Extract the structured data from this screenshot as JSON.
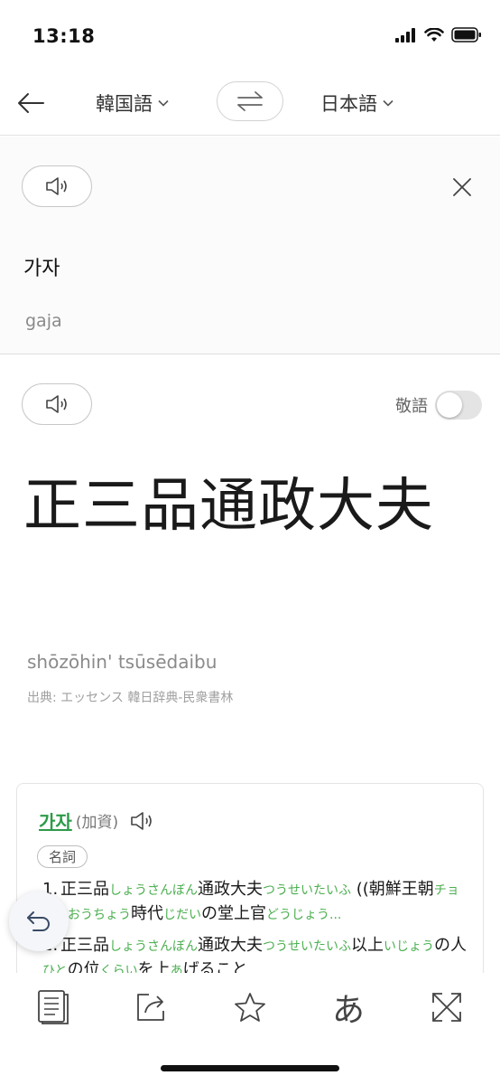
{
  "status_bar": {
    "time": "13:18"
  },
  "header": {
    "source_lang": "韓国語",
    "target_lang": "日本語"
  },
  "source": {
    "text": "가자",
    "romanization": "gaja"
  },
  "result": {
    "honorific_label": "敬語",
    "honorific_enabled": false,
    "text": "正三品通政大夫",
    "romanization": "shōzōhin' tsūsēdaibu",
    "credit": "出典: エッセンス 韓日辞典-民衆書林"
  },
  "dictionary": {
    "headword": "가자",
    "hanja": "(加資)",
    "pos": "名詞",
    "definitions": [
      {
        "num": "1.",
        "parts": [
          {
            "t": "正三品",
            "ruby": "しょうさんぼん"
          },
          {
            "t": "通政大夫",
            "ruby": "つうせいたいふ"
          },
          {
            "t": " ((朝鮮王朝",
            "ruby": "チョソンおうちょう"
          },
          {
            "t": "時代",
            "ruby": "じだい"
          },
          {
            "t": "の堂上官",
            "ruby": "どうじょう..."
          }
        ]
      },
      {
        "num": "2.",
        "parts": [
          {
            "t": "正三品",
            "ruby": "しょうさんぼん"
          },
          {
            "t": "通政大夫",
            "ruby": "つうせいたいふ"
          },
          {
            "t": "以上",
            "ruby": "いじょう"
          },
          {
            "t": "の人",
            "ruby": "ひと"
          },
          {
            "t": "の位",
            "ruby": "くらい"
          },
          {
            "t": "を上",
            "ruby": "あ"
          },
          {
            "t": "げること",
            "ruby": ""
          }
        ]
      }
    ]
  },
  "toolbar": {
    "kana_label": "あ",
    "icons": [
      "dictionary-icon",
      "share-icon",
      "star-icon",
      "kana-icon",
      "fullscreen-icon"
    ]
  },
  "colors": {
    "accent_green": "#2d9b47",
    "ruby_green": "#4caf50",
    "text_dark": "#1a1a1a",
    "text_gray": "#8a8a8a"
  }
}
